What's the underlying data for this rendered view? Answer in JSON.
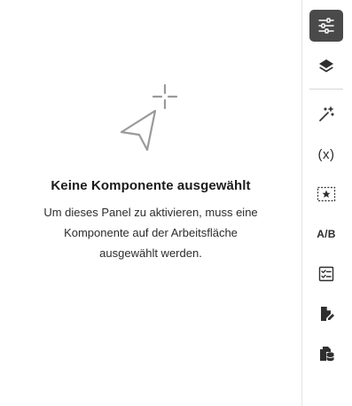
{
  "empty_state": {
    "icon": "select-pointer-sparkle-icon",
    "title": "Keine Komponente ausgewählt",
    "description": "Um dieses Panel zu aktivieren, muss eine Komponente auf der Arbeitsfläche ausgewählt werden."
  },
  "rail": {
    "items": [
      {
        "icon": "properties-sliders-icon",
        "active": true
      },
      {
        "icon": "layers-icon",
        "active": false
      },
      {
        "icon": "magic-wand-icon",
        "active": false
      },
      {
        "icon": "variables-icon",
        "label": "(x)",
        "active": false
      },
      {
        "icon": "favorite-star-frame-icon",
        "active": false
      },
      {
        "icon": "ab-test-icon",
        "label": "A/B",
        "active": false
      },
      {
        "icon": "checklist-icon",
        "active": false
      },
      {
        "icon": "page-edit-icon",
        "active": false
      },
      {
        "icon": "page-database-icon",
        "active": false
      }
    ]
  },
  "colors": {
    "active_bg": "#4a4a4a",
    "icon": "#323232",
    "illustration": "#9a9a9a",
    "divider": "#d5d5d5"
  }
}
